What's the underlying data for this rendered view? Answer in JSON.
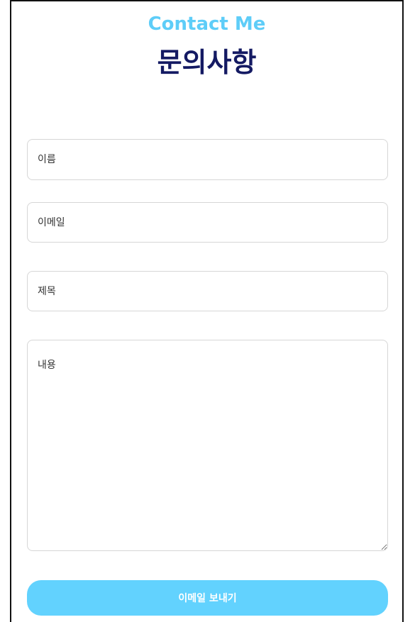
{
  "header": {
    "kicker": "Contact Me",
    "title": "문의사항"
  },
  "form": {
    "name_placeholder": "이름",
    "email_placeholder": "이메일",
    "subject_placeholder": "제목",
    "message_placeholder": "내용",
    "submit_label": "이메일 보내기"
  },
  "colors": {
    "accent": "#62d2fe",
    "title": "#141a63"
  }
}
